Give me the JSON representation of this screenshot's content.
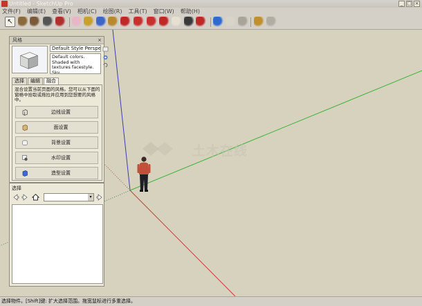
{
  "window": {
    "title": "Untitled - SketchUp Pro",
    "controls": [
      "_",
      "□",
      "×"
    ]
  },
  "menubar": {
    "items": [
      "文件(F)",
      "编辑(E)",
      "查看(V)",
      "相机(C)",
      "绘图(R)",
      "工具(T)",
      "窗口(W)",
      "帮助(H)"
    ]
  },
  "toolbar": {
    "tools": [
      {
        "name": "select-tool-icon",
        "color": "#2b2b2b"
      },
      {
        "name": "rectangle-tool-icon",
        "color": "#8a6a3a"
      },
      {
        "name": "circle-tool-icon",
        "color": "#7a5a3a"
      },
      {
        "name": "arc-tool-icon",
        "color": "#555555"
      },
      {
        "name": "pencil-tool-icon",
        "color": "#b03030"
      },
      {
        "name": "eraser-tool-icon",
        "color": "#e8b6c6"
      },
      {
        "name": "tape-measure-icon",
        "color": "#c8a030"
      },
      {
        "name": "paint-bucket-icon",
        "color": "#3c66c8"
      },
      {
        "name": "push-pull-icon",
        "color": "#b8892e"
      },
      {
        "name": "move-tool-icon",
        "color": "#c02828"
      },
      {
        "name": "rotate-tool-icon",
        "color": "#c83030"
      },
      {
        "name": "follow-me-icon",
        "color": "#c83030"
      },
      {
        "name": "orbit-tool-icon",
        "color": "#c02828"
      },
      {
        "name": "pan-tool-icon",
        "color": "#e6e0d0"
      },
      {
        "name": "zoom-tool-icon",
        "color": "#3a3a3a"
      },
      {
        "name": "zoom-extents-icon",
        "color": "#c02828"
      },
      {
        "name": "get-models-icon",
        "color": "#2d6ad2"
      },
      {
        "name": "share-model-icon",
        "color": "#d8d4c8"
      },
      {
        "name": "share-component-icon",
        "color": "#a8a498"
      },
      {
        "name": "extension-warehouse-icon",
        "color": "#c0902e"
      },
      {
        "name": "layout-send-icon",
        "color": "#b0ada3"
      }
    ]
  },
  "styles_panel": {
    "title": "风格",
    "close_label": "×",
    "style_name": "Default Style Perspective",
    "style_description": "Default colors.  Shaded with textures facestyle.  Sky",
    "tabs": [
      {
        "label": "选择",
        "active": false
      },
      {
        "label": "编辑",
        "active": false
      },
      {
        "label": "融合",
        "active": true
      }
    ],
    "instructions": "混合设置当前页面的风格。您可以从下面的窗格中拾取或拖拉并应用到您想要的风格中。",
    "settings": [
      {
        "label": "边线设置",
        "icon": "edge-settings-icon"
      },
      {
        "label": "面设置",
        "icon": "face-settings-icon"
      },
      {
        "label": "背景设置",
        "icon": "background-settings-icon"
      },
      {
        "label": "水印设置",
        "icon": "watermark-settings-icon"
      },
      {
        "label": "造型设置",
        "icon": "modeling-settings-icon"
      }
    ]
  },
  "select_pane": {
    "title": "选择",
    "combo_value": ""
  },
  "viewport": {
    "background": "#d6d2bd",
    "axis_colors": {
      "blue": "#3c3cb4",
      "green": "#3cb43c",
      "red": "#c83c3c"
    }
  },
  "watermark": {
    "text": "土木在线"
  },
  "statusbar": {
    "text": "选择物件。[Shift]键: 扩大选择范围。拖宽鼠标进行多重选择。"
  }
}
